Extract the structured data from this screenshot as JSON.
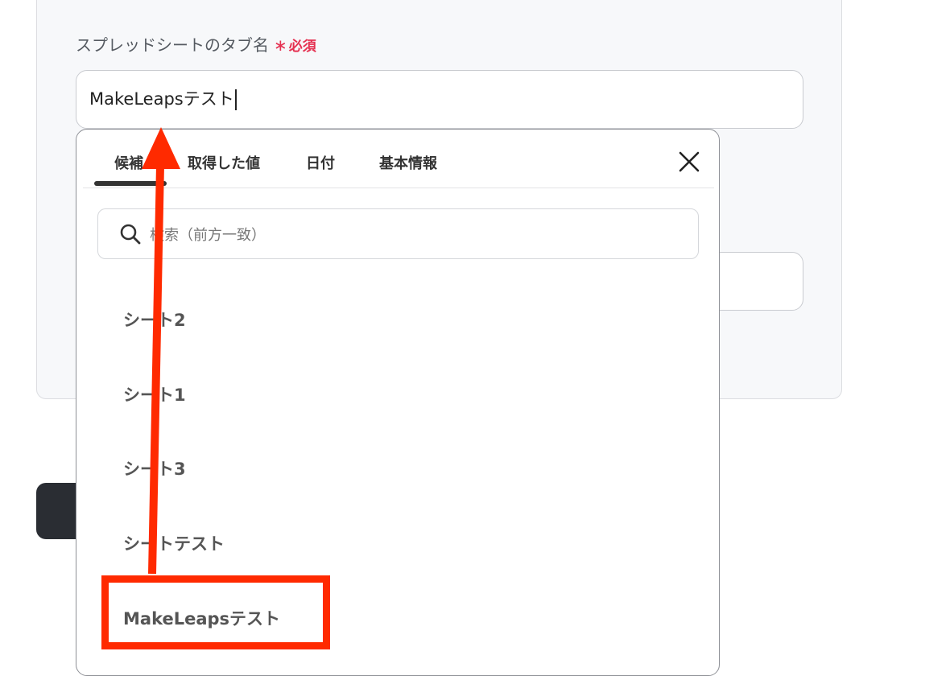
{
  "field": {
    "label": "スプレッドシートのタブ名",
    "required_star": "∗",
    "required_text": "必須",
    "value": "MakeLeapsテスト"
  },
  "popup": {
    "tabs": [
      {
        "label": "候補"
      },
      {
        "label": "取得した値"
      },
      {
        "label": "日付"
      },
      {
        "label": "基本情報"
      }
    ],
    "active_tab": "候補",
    "search_placeholder": "検索（前方一致）",
    "options": [
      {
        "label": "シート2"
      },
      {
        "label": "シート1"
      },
      {
        "label": "シート3"
      },
      {
        "label": "シートテスト"
      },
      {
        "label": "MakeLeapsテスト"
      }
    ]
  },
  "colors": {
    "required": "#e53151",
    "annotation": "#ff2a00",
    "dark_button": "#2a2d33"
  },
  "icons": {
    "close": "close-icon",
    "search": "search-icon"
  }
}
